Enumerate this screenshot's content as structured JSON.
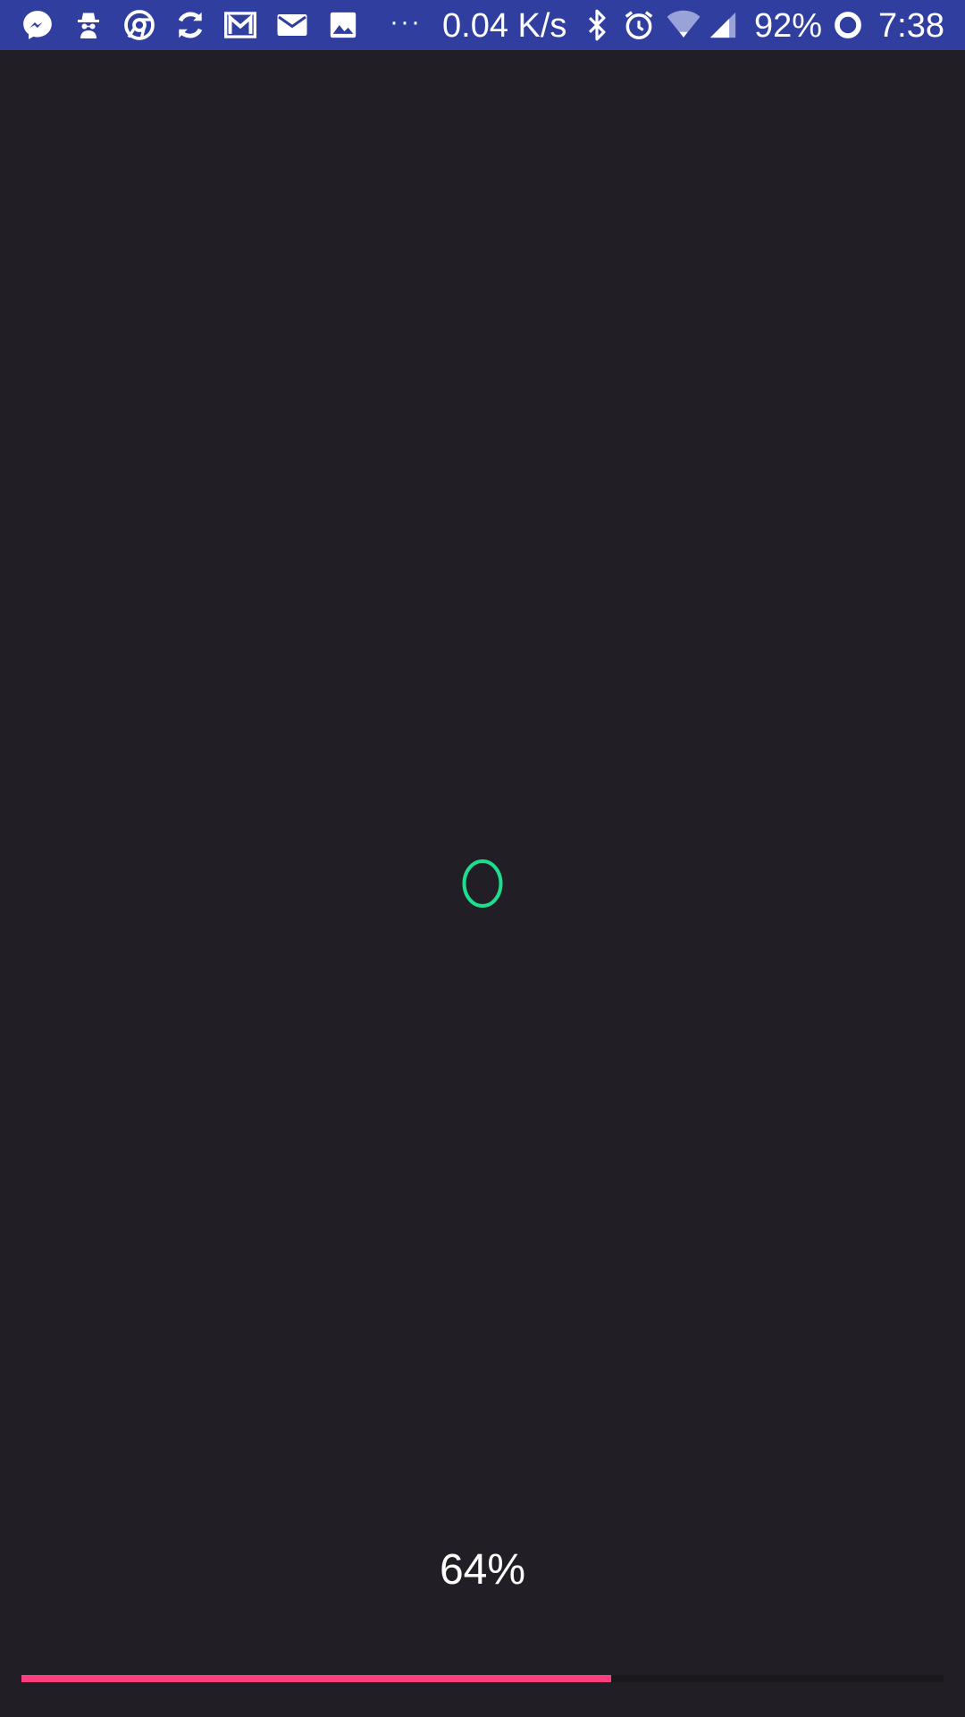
{
  "status_bar": {
    "background_color": "#303f9f",
    "notification_icons": [
      "messenger-icon",
      "incognito-spy-icon",
      "chrome-icon",
      "sync-icon",
      "gmail-icon",
      "email-icon",
      "gallery-image-icon"
    ],
    "overflow_label": "···",
    "network_speed": "0.04 K/s",
    "system_icons": [
      "bluetooth-icon",
      "alarm-icon",
      "wifi-icon",
      "cellular-signal-icon"
    ],
    "battery_percent": "92%",
    "battery_icon": "battery-ring-icon",
    "time": "7:38"
  },
  "loader": {
    "spinner_icon": "loading-ring-icon",
    "spinner_color": "#1fdc8f",
    "progress_label": "64%",
    "progress_fraction": 0.64,
    "progress_color": "#ff3d7f",
    "track_color": "#1a181c"
  }
}
